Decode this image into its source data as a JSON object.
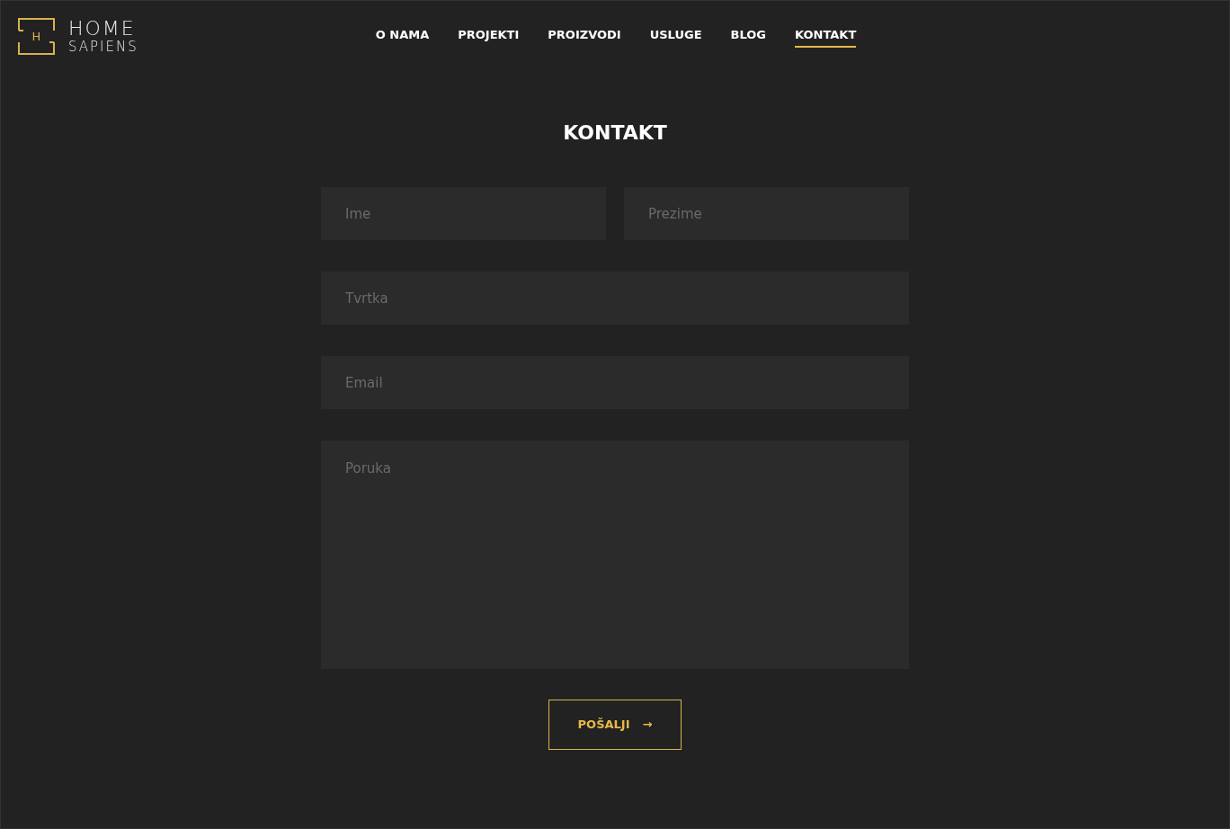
{
  "logo": {
    "mark": "H",
    "line1": "HOME",
    "line2": "SAPIENS"
  },
  "nav": [
    {
      "label": "O NAMA",
      "selected": false
    },
    {
      "label": "PROJEKTI",
      "selected": false
    },
    {
      "label": "PROIZVODI",
      "selected": false
    },
    {
      "label": "USLUGE",
      "selected": false
    },
    {
      "label": "BLOG",
      "selected": false
    },
    {
      "label": "KONTAKT",
      "selected": true
    }
  ],
  "title": "KONTAKT",
  "form": {
    "first_name": {
      "placeholder": "Ime"
    },
    "last_name": {
      "placeholder": "Prezime"
    },
    "company": {
      "placeholder": "Tvrtka"
    },
    "email": {
      "placeholder": "Email"
    },
    "message": {
      "placeholder": "Poruka"
    }
  },
  "submit": {
    "label": "POŠALJI",
    "arrow": "→"
  }
}
